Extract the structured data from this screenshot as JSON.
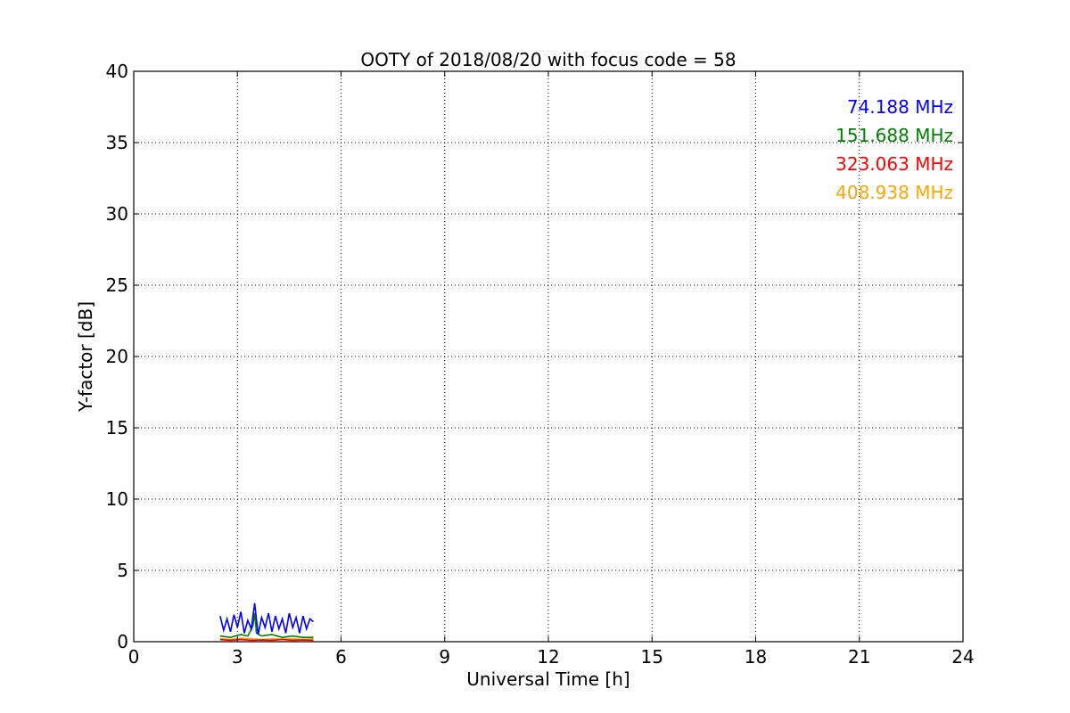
{
  "chart_data": {
    "type": "line",
    "title": "OOTY of 2018/08/20 with focus code = 58",
    "xlabel": "Universal Time [h]",
    "ylabel": "Y-factor [dB]",
    "xlim": [
      0,
      24
    ],
    "ylim": [
      0,
      40
    ],
    "xticks": [
      0,
      3,
      6,
      9,
      12,
      15,
      18,
      21,
      24
    ],
    "yticks": [
      0,
      5,
      10,
      15,
      20,
      25,
      30,
      35,
      40
    ],
    "grid": true,
    "legend_position": "top-right",
    "series": [
      {
        "name": "74.188 MHz",
        "color": "#0000ff",
        "x": [
          2.5,
          2.6,
          2.7,
          2.8,
          2.9,
          3.0,
          3.1,
          3.2,
          3.3,
          3.4,
          3.5,
          3.6,
          3.7,
          3.8,
          3.9,
          4.0,
          4.1,
          4.2,
          4.3,
          4.4,
          4.5,
          4.6,
          4.7,
          4.8,
          4.9,
          5.0,
          5.1,
          5.2
        ],
        "y": [
          1.8,
          0.8,
          1.6,
          0.7,
          1.9,
          1.0,
          2.1,
          0.6,
          1.5,
          0.9,
          2.7,
          0.5,
          1.7,
          1.0,
          2.0,
          0.7,
          1.8,
          0.9,
          1.6,
          0.6,
          2.0,
          1.0,
          1.7,
          0.6,
          1.8,
          0.9,
          1.6,
          1.4
        ]
      },
      {
        "name": "151.688 MHz",
        "color": "#008000",
        "x": [
          2.5,
          2.8,
          3.1,
          3.3,
          3.45,
          3.5,
          3.55,
          3.7,
          4.0,
          4.3,
          4.6,
          4.9,
          5.2
        ],
        "y": [
          0.4,
          0.3,
          0.5,
          0.4,
          1.1,
          2.0,
          0.6,
          0.4,
          0.5,
          0.3,
          0.4,
          0.3,
          0.3
        ]
      },
      {
        "name": "323.063 MHz",
        "color": "#ff0000",
        "x": [
          2.5,
          2.8,
          3.1,
          3.4,
          3.7,
          4.0,
          4.3,
          4.6,
          4.9,
          5.2
        ],
        "y": [
          0.15,
          0.1,
          0.15,
          0.1,
          0.12,
          0.1,
          0.15,
          0.1,
          0.12,
          0.1
        ]
      },
      {
        "name": "408.938 MHz",
        "color": "#ffa500",
        "x": [
          2.5,
          2.8,
          3.1,
          3.4,
          3.7,
          4.0,
          4.3,
          4.6,
          4.9,
          5.2
        ],
        "y": [
          0.2,
          0.15,
          0.25,
          0.2,
          0.15,
          0.2,
          0.18,
          0.2,
          0.15,
          0.2
        ]
      }
    ]
  }
}
